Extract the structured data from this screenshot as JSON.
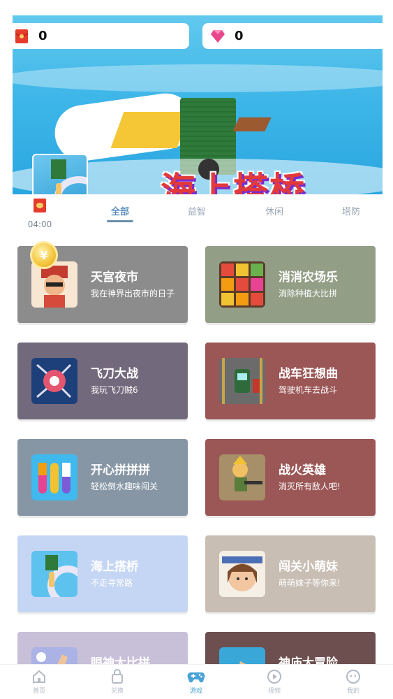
{
  "counters": {
    "red_envelope_count": "0",
    "diamond_count": "0"
  },
  "banner": {
    "title": "海上搭桥"
  },
  "timer": {
    "time": "04:00"
  },
  "tabs": [
    {
      "label": "全部",
      "active": true
    },
    {
      "label": "益智",
      "active": false
    },
    {
      "label": "休闲",
      "active": false
    },
    {
      "label": "塔防",
      "active": false
    }
  ],
  "coin_badge": "¥",
  "games": [
    {
      "name": "天宫夜市",
      "desc": "我在神界出夜市的日子",
      "color": "#8c8c8c",
      "icon": "night-market-icon"
    },
    {
      "name": "消消农场乐",
      "desc": "消除种植大比拼",
      "color": "#939e86",
      "icon": "farm-match-icon"
    },
    {
      "name": "飞刀大战",
      "desc": "我玩飞刀贼6",
      "color": "#73697c",
      "icon": "flying-knife-icon"
    },
    {
      "name": "战车狂想曲",
      "desc": "驾驶机车去战斗",
      "color": "#9b5656",
      "icon": "chariot-icon"
    },
    {
      "name": "开心拼拼拼",
      "desc": "轻松倒水趣味闯关",
      "color": "#8796a5",
      "icon": "water-sort-icon"
    },
    {
      "name": "战火英雄",
      "desc": "消灭所有敌人吧!",
      "color": "#9b5656",
      "icon": "war-hero-icon"
    },
    {
      "name": "海上搭桥",
      "desc": "不走寻常路",
      "color": "#c5d6f4",
      "icon": "sea-bridge-icon"
    },
    {
      "name": "闯关小萌妹",
      "desc": "萌萌妹子等你来!",
      "color": "#c9beb4",
      "icon": "cute-girl-icon"
    },
    {
      "name": "眼神大比拼",
      "desc": "",
      "color": "#c8bfd9",
      "icon": "eye-contest-icon"
    },
    {
      "name": "神庙大冒险",
      "desc": "",
      "color": "#6d4f4f",
      "icon": "temple-run-icon"
    }
  ],
  "nav": [
    {
      "label": "首页",
      "icon": "home-icon",
      "active": false
    },
    {
      "label": "兑换",
      "icon": "bag-icon",
      "active": false
    },
    {
      "label": "游戏",
      "icon": "gamepad-icon",
      "active": true
    },
    {
      "label": "视频",
      "icon": "play-icon",
      "active": false
    },
    {
      "label": "我的",
      "icon": "face-icon",
      "active": false
    }
  ],
  "colors": {
    "active_tab": "#5c8fbd",
    "active_nav": "#4aa3d8",
    "inactive": "#b3bac4"
  }
}
